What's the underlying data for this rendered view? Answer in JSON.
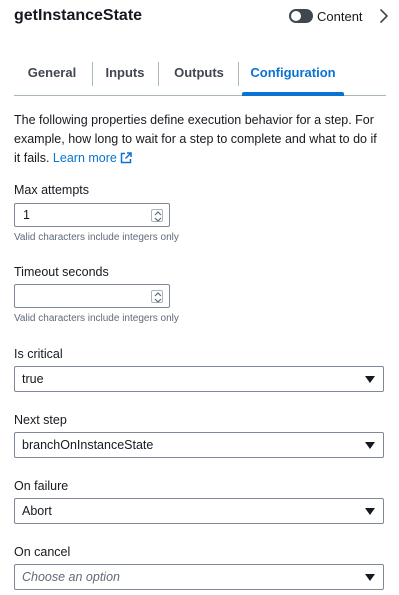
{
  "header": {
    "title": "getInstanceState",
    "toggle_label": "Content"
  },
  "tabs": [
    {
      "label": "General",
      "active": false
    },
    {
      "label": "Inputs",
      "active": false
    },
    {
      "label": "Outputs",
      "active": false
    },
    {
      "label": "Configuration",
      "active": true
    }
  ],
  "description": {
    "text": "The following properties define execution behavior for a step. For example, how long to wait for a step to complete and what to do if it fails.",
    "link_text": "Learn more"
  },
  "fields": {
    "max_attempts": {
      "label": "Max attempts",
      "value": "1",
      "hint": "Valid characters include integers only"
    },
    "timeout_seconds": {
      "label": "Timeout seconds",
      "value": "",
      "hint": "Valid characters include integers only"
    },
    "is_critical": {
      "label": "Is critical",
      "value": "true"
    },
    "next_step": {
      "label": "Next step",
      "value": "branchOnInstanceState"
    },
    "on_failure": {
      "label": "On failure",
      "value": "Abort"
    },
    "on_cancel": {
      "label": "On cancel",
      "placeholder": "Choose an option"
    }
  },
  "colors": {
    "accent": "#0972d3",
    "text": "#16191f",
    "muted": "#5f6b7a",
    "border": "#7d8998"
  },
  "icons": [
    "toggle-switch-icon",
    "chevron-right-icon",
    "external-link-icon",
    "spinner-icon",
    "caret-down-icon"
  ]
}
